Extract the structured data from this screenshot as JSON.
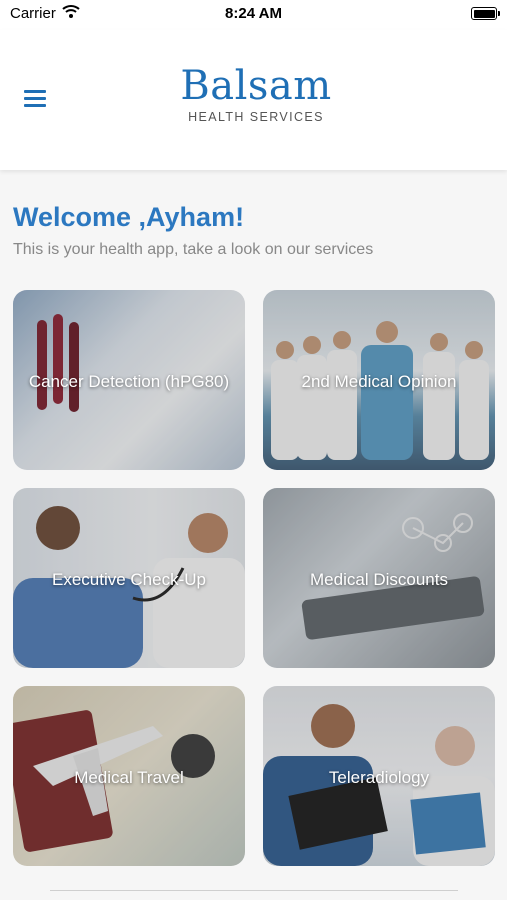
{
  "status_bar": {
    "carrier": "Carrier",
    "time": "8:24 AM"
  },
  "header": {
    "logo_name": "Balsam",
    "logo_sub": "HEALTH SERVICES"
  },
  "welcome": {
    "title": "Welcome ,Ayham!",
    "subtitle": "This is your health app, take a look on our services"
  },
  "services": [
    {
      "label": "Cancer Detection (hPG80)"
    },
    {
      "label": "2nd Medical Opinion"
    },
    {
      "label": "Executive Check-Up"
    },
    {
      "label": "Medical Discounts"
    },
    {
      "label": "Medical Travel"
    },
    {
      "label": "Teleradiology"
    }
  ],
  "colors": {
    "brand": "#1f6fb5",
    "welcome": "#2c78c0"
  }
}
